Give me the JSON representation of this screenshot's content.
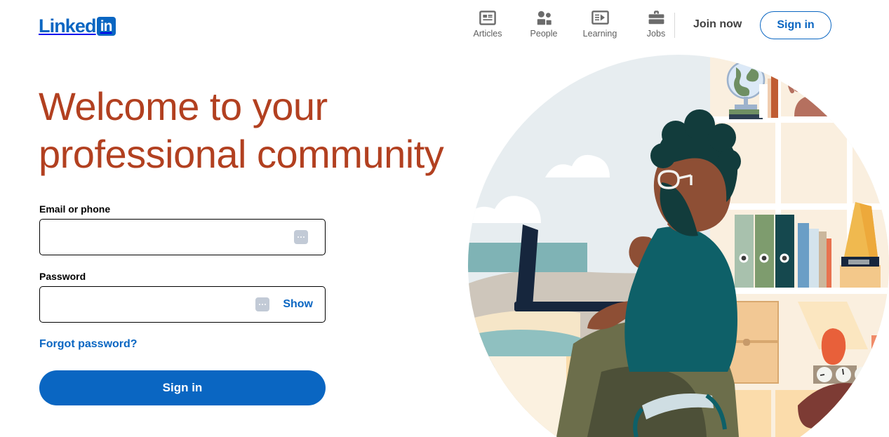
{
  "header": {
    "logo": {
      "word": "Linked",
      "badge": "in",
      "name": "LinkedIn"
    },
    "nav": [
      {
        "label": "Articles",
        "icon": "articles-icon"
      },
      {
        "label": "People",
        "icon": "people-icon"
      },
      {
        "label": "Learning",
        "icon": "learning-icon"
      },
      {
        "label": "Jobs",
        "icon": "jobs-icon"
      }
    ],
    "join_now_label": "Join now",
    "sign_in_label": "Sign in"
  },
  "hero": {
    "headline_line1": "Welcome to your",
    "headline_line2": "professional community"
  },
  "form": {
    "email_label": "Email or phone",
    "email_value": "",
    "email_placeholder": "",
    "password_label": "Password",
    "password_value": "",
    "password_placeholder": "",
    "show_label": "Show",
    "forgot_label": "Forgot password?",
    "submit_label": "Sign in"
  },
  "colors": {
    "brand_blue": "#0a66c2",
    "headline_rust": "#b24020",
    "nav_gray": "#5f5f5f",
    "join_now_gray": "#404040",
    "autofill_chip": "#c2cad6",
    "illustration_sky": "#e7edf0",
    "illustration_shelf": "#faefdf",
    "illustration_shirt": "#0e6068",
    "illustration_skin": "#8e4f35",
    "illustration_hair": "#123c3c",
    "illustration_pants": "#6c6e4b",
    "illustration_laptop": "#16263d",
    "illustration_lamp": "#e8603a",
    "illustration_cat": "#b5705f"
  },
  "illustration": {
    "name": "professional-at-desk-illustration",
    "elements": [
      "globe",
      "books",
      "cat",
      "binders",
      "vase",
      "lamp",
      "clocks",
      "laptop",
      "person",
      "chair",
      "bookshelf",
      "clouds"
    ]
  }
}
